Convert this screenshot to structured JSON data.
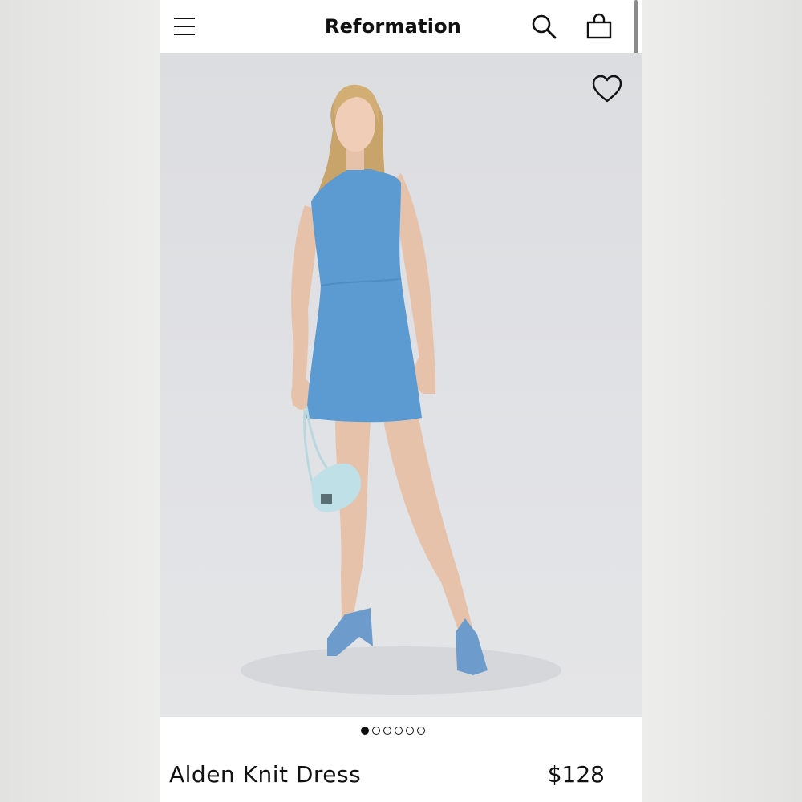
{
  "header": {
    "brand": "Reformation",
    "menu_icon": "hamburger-menu-icon",
    "search_icon": "search-icon",
    "bag_icon": "shopping-bag-icon"
  },
  "gallery": {
    "wishlist_icon": "heart-outline-icon",
    "image_description_icon": "product-photo",
    "pager": {
      "total": 6,
      "active_index": 0
    }
  },
  "product": {
    "name": "Alden Knit Dress",
    "price": "$128"
  },
  "colors": {
    "dress": "#5b9bd1",
    "backdrop": "#dfe0e3",
    "text": "#111111"
  }
}
